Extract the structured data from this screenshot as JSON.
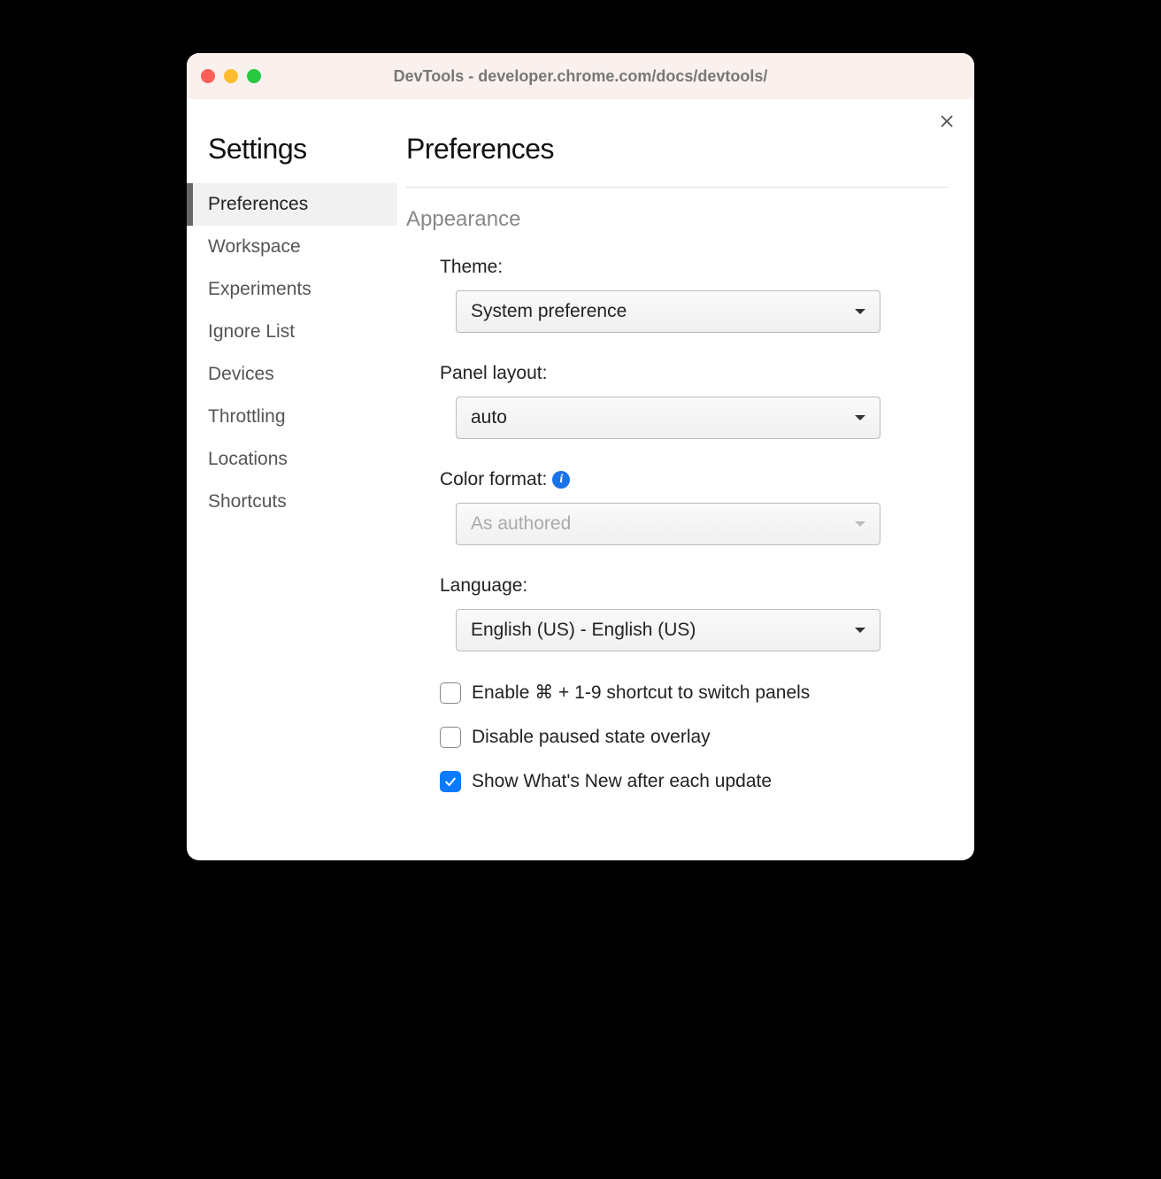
{
  "titlebar": {
    "title": "DevTools - developer.chrome.com/docs/devtools/"
  },
  "sidebar": {
    "title": "Settings",
    "items": [
      {
        "label": "Preferences",
        "selected": true
      },
      {
        "label": "Workspace",
        "selected": false
      },
      {
        "label": "Experiments",
        "selected": false
      },
      {
        "label": "Ignore List",
        "selected": false
      },
      {
        "label": "Devices",
        "selected": false
      },
      {
        "label": "Throttling",
        "selected": false
      },
      {
        "label": "Locations",
        "selected": false
      },
      {
        "label": "Shortcuts",
        "selected": false
      }
    ]
  },
  "main": {
    "title": "Preferences",
    "section": "Appearance",
    "theme": {
      "label": "Theme:",
      "value": "System preference"
    },
    "panel_layout": {
      "label": "Panel layout:",
      "value": "auto"
    },
    "color_format": {
      "label": "Color format:",
      "value": "As authored",
      "disabled": true,
      "has_info": true
    },
    "language": {
      "label": "Language:",
      "value": "English (US) - English (US)"
    },
    "checkboxes": [
      {
        "label": "Enable ⌘ + 1-9 shortcut to switch panels",
        "checked": false
      },
      {
        "label": "Disable paused state overlay",
        "checked": false
      },
      {
        "label": "Show What's New after each update",
        "checked": true
      }
    ]
  }
}
